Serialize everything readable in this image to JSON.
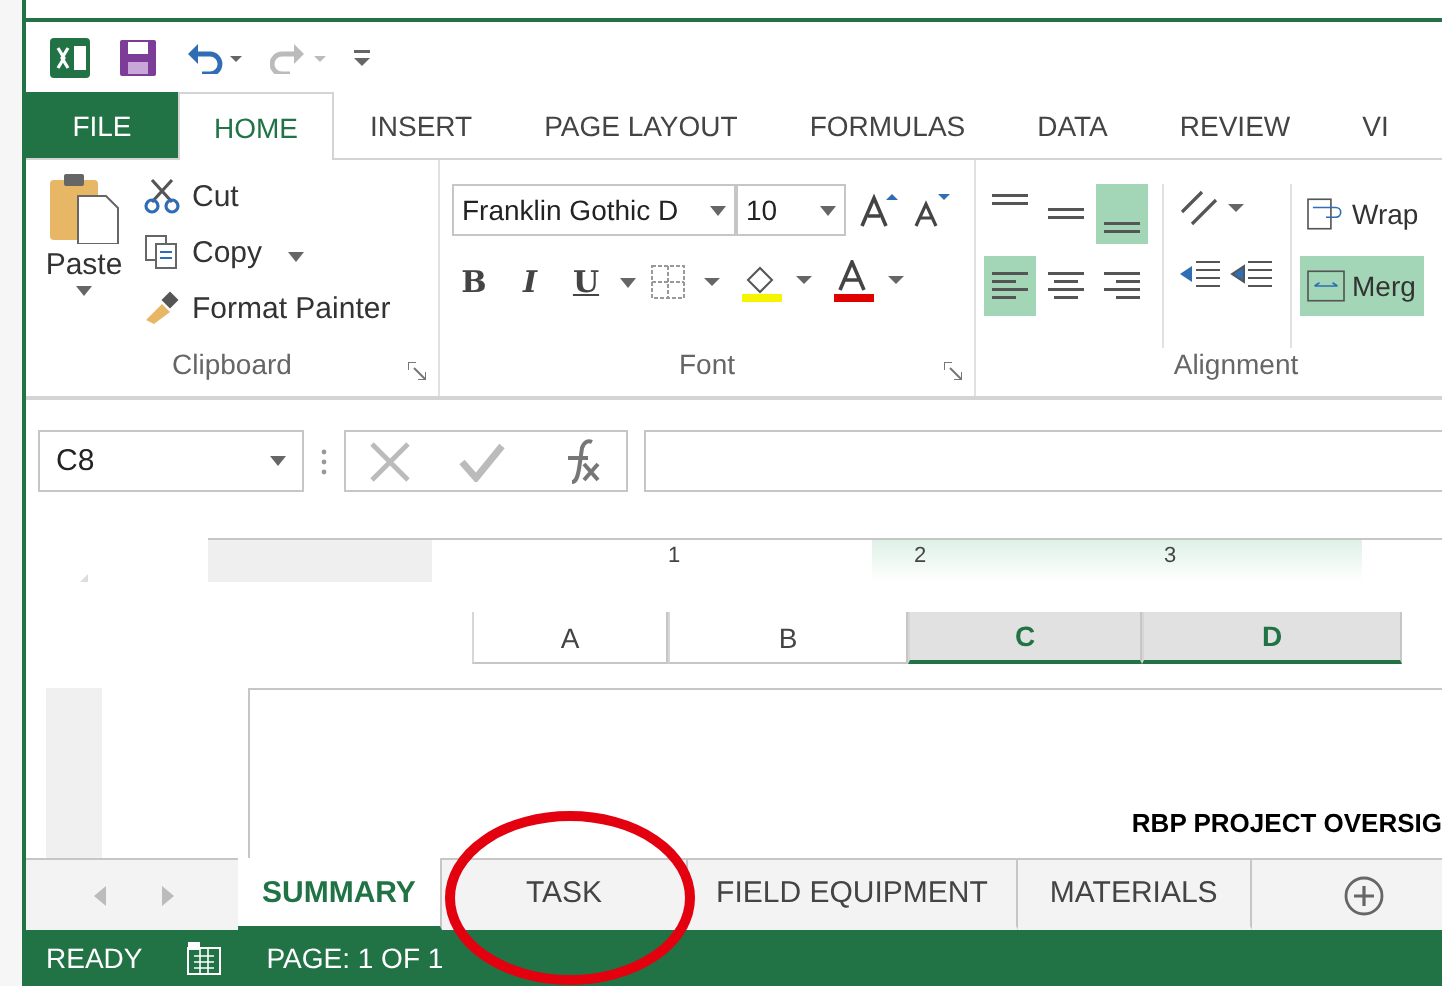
{
  "ribbon_tabs": [
    {
      "label": "FILE",
      "kind": "file",
      "selected": false
    },
    {
      "label": "HOME",
      "kind": "tab",
      "selected": true
    },
    {
      "label": "INSERT",
      "kind": "tab",
      "selected": false
    },
    {
      "label": "PAGE LAYOUT",
      "kind": "tab",
      "selected": false
    },
    {
      "label": "FORMULAS",
      "kind": "tab",
      "selected": false
    },
    {
      "label": "DATA",
      "kind": "tab",
      "selected": false
    },
    {
      "label": "REVIEW",
      "kind": "tab",
      "selected": false
    },
    {
      "label": "VI",
      "kind": "tab",
      "selected": false
    }
  ],
  "clipboard": {
    "title": "Clipboard",
    "paste": "Paste",
    "cut": "Cut",
    "copy": "Copy",
    "format_painter": "Format Painter"
  },
  "font": {
    "title": "Font",
    "font_name": "Franklin Gothic D",
    "font_size": "10",
    "bold": "B",
    "italic": "I",
    "underline": "U"
  },
  "alignment": {
    "title": "Alignment",
    "wrap": "Wrap",
    "merge": "Merg",
    "merge_selected": true,
    "vertical": [
      {
        "kind": "top",
        "selected": false
      },
      {
        "kind": "middle",
        "selected": false
      },
      {
        "kind": "bottom",
        "selected": true
      }
    ],
    "horizontal": [
      {
        "kind": "left",
        "selected": true
      },
      {
        "kind": "center",
        "selected": false
      },
      {
        "kind": "right",
        "selected": false
      }
    ]
  },
  "name_box": "C8",
  "ruler": [
    "1",
    "2",
    "3"
  ],
  "columns": [
    {
      "label": "A",
      "selected": false
    },
    {
      "label": "B",
      "selected": false
    },
    {
      "label": "C",
      "selected": true
    },
    {
      "label": "D",
      "selected": true
    }
  ],
  "page_text": "RBP PROJECT OVERSIG",
  "sheet_tabs": [
    {
      "label": "SUMMARY",
      "selected": true
    },
    {
      "label": "TASK",
      "selected": false
    },
    {
      "label": "FIELD EQUIPMENT",
      "selected": false
    },
    {
      "label": "MATERIALS",
      "selected": false
    }
  ],
  "status_bar": {
    "mode": "READY",
    "page": "PAGE: 1 OF 1"
  }
}
